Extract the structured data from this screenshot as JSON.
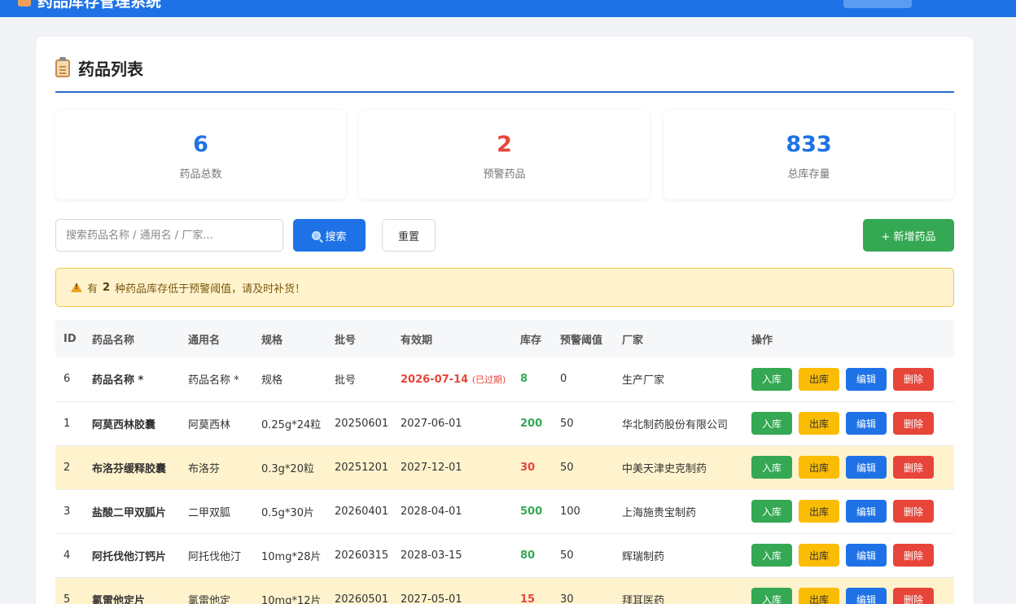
{
  "app": {
    "title": "药品库存管理系统"
  },
  "card": {
    "title": "药品列表"
  },
  "stats": [
    {
      "value": "6",
      "label": "药品总数"
    },
    {
      "value": "2",
      "label": "预警药品"
    },
    {
      "value": "833",
      "label": "总库存量"
    }
  ],
  "toolbar": {
    "search_placeholder": "搜索药品名称 / 通用名 / 厂家...",
    "search_label": "搜索",
    "reset_label": "重置",
    "add_label": "+ 新增药品"
  },
  "alert": {
    "prefix": "有",
    "count": "2",
    "suffix": "种药品库存低于预警阈值，请及时补货！"
  },
  "table": {
    "headers": [
      "ID",
      "药品名称",
      "通用名",
      "规格",
      "批号",
      "有效期",
      "库存",
      "预警阈值",
      "厂家",
      "操作"
    ],
    "actions": {
      "in": "入库",
      "out": "出库",
      "edit": "编辑",
      "delete": "删除"
    },
    "rows": [
      {
        "id": "6",
        "name": "药品名称 *",
        "generic": "药品名称 *",
        "spec": "规格",
        "batch": "批号",
        "expiry": "2026-07-14",
        "expiry_note": "(已过期)",
        "stock": "8",
        "threshold": "0",
        "maker": "生产厂家",
        "warn": false,
        "expired": true,
        "low": false
      },
      {
        "id": "1",
        "name": "阿莫西林胶囊",
        "generic": "阿莫西林",
        "spec": "0.25g*24粒",
        "batch": "20250601",
        "expiry": "2027-06-01",
        "expiry_note": "",
        "stock": "200",
        "threshold": "50",
        "maker": "华北制药股份有限公司",
        "warn": false,
        "expired": false,
        "low": false
      },
      {
        "id": "2",
        "name": "布洛芬缓释胶囊",
        "generic": "布洛芬",
        "spec": "0.3g*20粒",
        "batch": "20251201",
        "expiry": "2027-12-01",
        "expiry_note": "",
        "stock": "30",
        "threshold": "50",
        "maker": "中美天津史克制药",
        "warn": true,
        "expired": false,
        "low": true
      },
      {
        "id": "3",
        "name": "盐酸二甲双胍片",
        "generic": "二甲双胍",
        "spec": "0.5g*30片",
        "batch": "20260401",
        "expiry": "2028-04-01",
        "expiry_note": "",
        "stock": "500",
        "threshold": "100",
        "maker": "上海施贵宝制药",
        "warn": false,
        "expired": false,
        "low": false
      },
      {
        "id": "4",
        "name": "阿托伐他汀钙片",
        "generic": "阿托伐他汀",
        "spec": "10mg*28片",
        "batch": "20260315",
        "expiry": "2028-03-15",
        "expiry_note": "",
        "stock": "80",
        "threshold": "50",
        "maker": "辉瑞制药",
        "warn": false,
        "expired": false,
        "low": false
      },
      {
        "id": "5",
        "name": "氯雷他定片",
        "generic": "氯雷他定",
        "spec": "10mg*12片",
        "batch": "20260501",
        "expiry": "2027-05-01",
        "expiry_note": "",
        "stock": "15",
        "threshold": "30",
        "maker": "拜耳医药",
        "warn": true,
        "expired": false,
        "low": true
      }
    ]
  }
}
